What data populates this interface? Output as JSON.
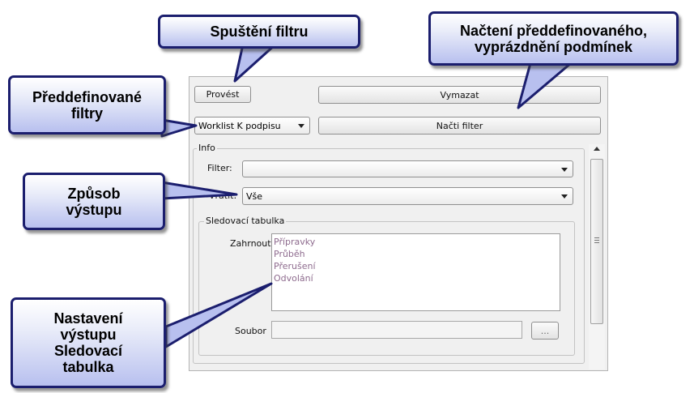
{
  "toolbar": {
    "run_label": "Provést",
    "clear_label": "Vymazat",
    "load_filter_label": "Načti filter",
    "predefined_filter_value": "Worklist K podpisu"
  },
  "info": {
    "legend": "Info",
    "filter_label": "Filter:",
    "filter_value": "",
    "return_label": "Vrátit:",
    "return_value": "Vše"
  },
  "tracking": {
    "legend": "Sledovací tabulka",
    "include_label": "Zahrnout",
    "include_items": [
      "Přípravky",
      "Průběh",
      "Přerušení",
      "Odvolání"
    ],
    "file_label": "Soubor",
    "file_value": "",
    "browse_label": "..."
  },
  "callouts": {
    "run_filter": "Spuštění filtru",
    "load_predefined": "Načtení předdefinovaného,\nvyprázdnění podmínek",
    "predefined_filters": "Předdefinované\nfiltry",
    "output_mode": "Způsob\nvýstupu",
    "output_settings": "Nastavení\nvýstupu\nSledovací\ntabulka"
  },
  "colors": {
    "callout_border": "#1b1e6e",
    "callout_fill_bottom": "#b8c0ef",
    "list_item_text": "#8e6b8e"
  }
}
